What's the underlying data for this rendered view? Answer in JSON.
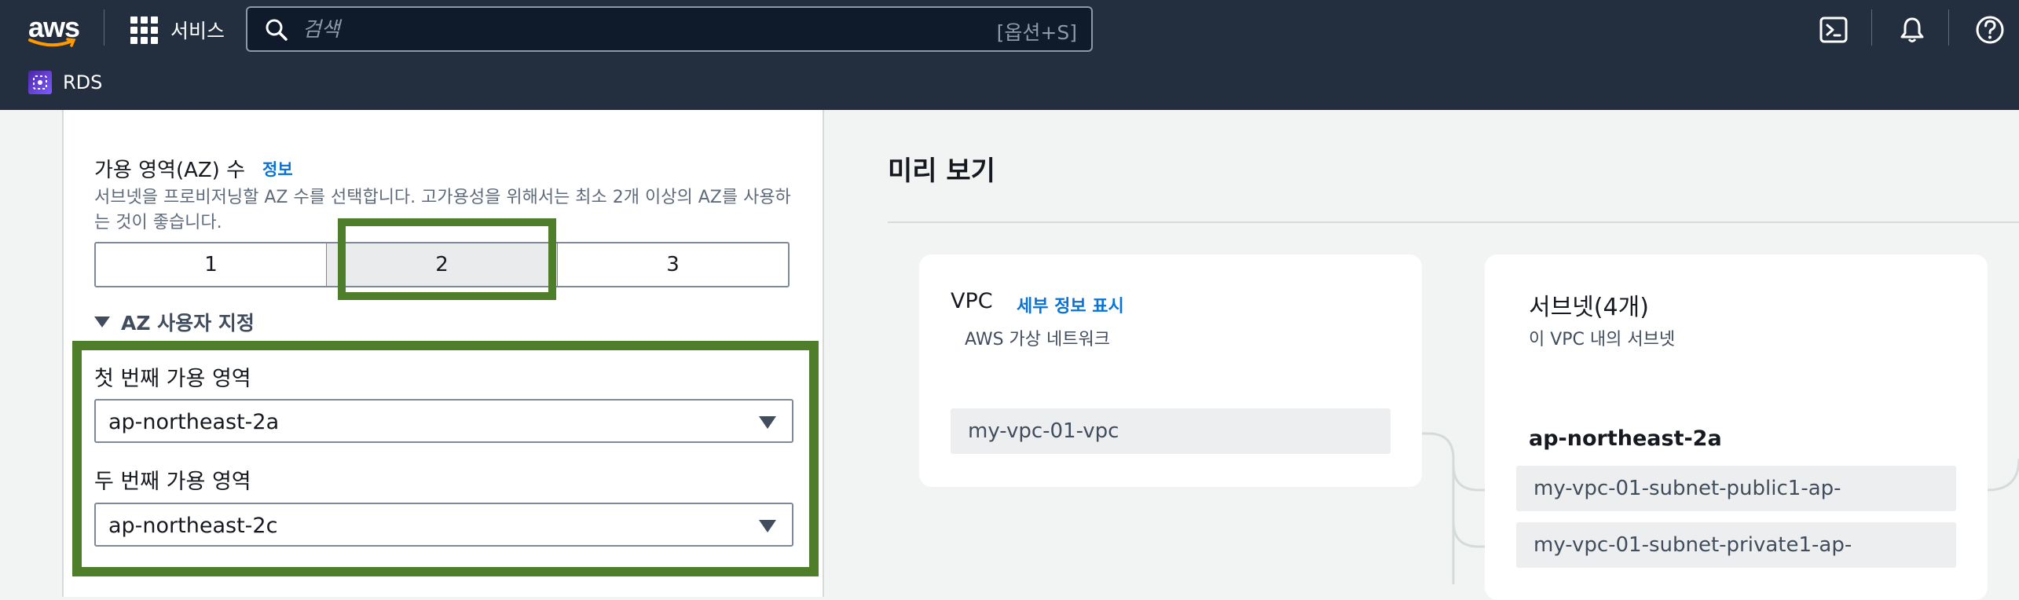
{
  "topbar": {
    "logo_text": "aws",
    "services_label": "서비스",
    "search_placeholder": "검색",
    "search_shortcut": "[옵션+S]",
    "icons": [
      "cloudshell-icon",
      "bell-icon",
      "help-icon"
    ],
    "service_name": "RDS"
  },
  "config": {
    "az_title": "가용 영역(AZ) 수",
    "az_info_link": "정보",
    "az_description": "서브넷을 프로비저닝할 AZ 수를 선택합니다. 고가용성을 위해서는 최소 2개 이상의 AZ를 사용하는 것이 좋습니다.",
    "az_options": [
      "1",
      "2",
      "3"
    ],
    "az_selected": "2",
    "customize_label": "AZ 사용자 지정",
    "first_az_label": "첫 번째 가용 영역",
    "first_az_value": "ap-northeast-2a",
    "second_az_label": "두 번째 가용 영역",
    "second_az_value": "ap-northeast-2c"
  },
  "preview": {
    "title": "미리 보기",
    "vpc": {
      "title": "VPC",
      "details_link": "세부 정보 표시",
      "subtitle": "AWS 가상 네트워크",
      "name": "my-vpc-01-vpc"
    },
    "subnets": {
      "title": "서브넷(4개)",
      "subtitle": "이 VPC 내의 서브넷",
      "az": "ap-northeast-2a",
      "items": [
        "my-vpc-01-subnet-public1-ap-",
        "my-vpc-01-subnet-private1-ap-"
      ]
    }
  },
  "colors": {
    "topbar_bg": "#232f3e",
    "link": "#0972d3",
    "highlight": "#4e7e2a",
    "page_bg": "#f2f3f3"
  }
}
